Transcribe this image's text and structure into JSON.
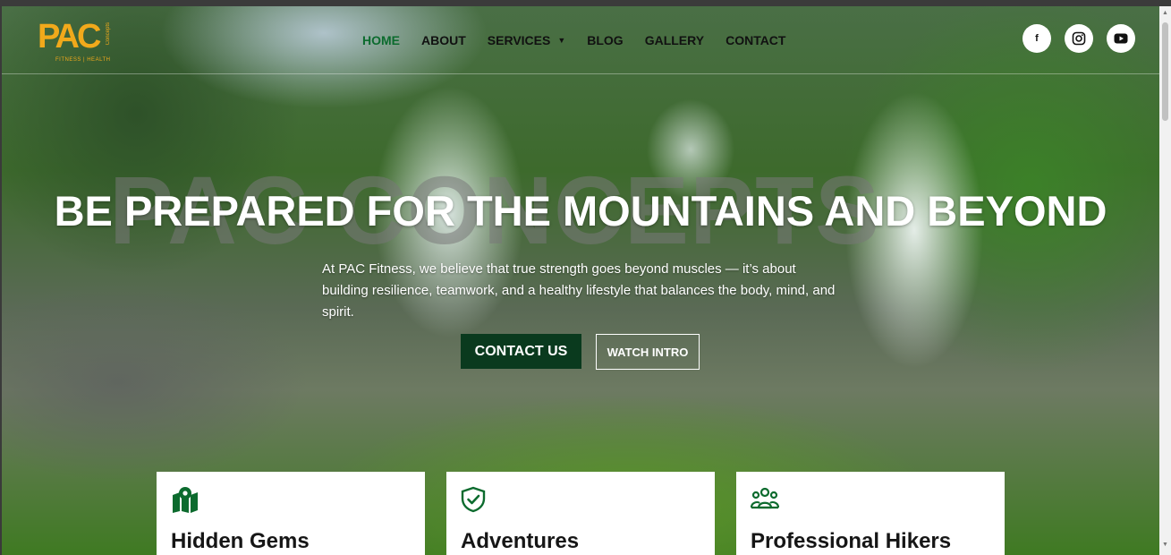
{
  "logo": {
    "text": "PAC",
    "tagline": "FITNESS | HEALTH",
    "side_text": "Concepts",
    "color": "#f1a91b"
  },
  "nav": {
    "items": [
      {
        "label": "HOME",
        "active": true
      },
      {
        "label": "ABOUT"
      },
      {
        "label": "SERVICES",
        "has_dropdown": true
      },
      {
        "label": "BLOG"
      },
      {
        "label": "GALLERY"
      },
      {
        "label": "CONTACT"
      }
    ],
    "active_color": "#0c6b2e"
  },
  "socials": [
    {
      "icon": "facebook-icon"
    },
    {
      "icon": "instagram-icon"
    },
    {
      "icon": "youtube-icon"
    }
  ],
  "hero": {
    "watermark": "PAC CONCEPTS",
    "headline": "BE PREPARED FOR THE MOUNTAINS AND BEYOND",
    "intro": "At PAC Fitness, we believe that true strength goes beyond muscles — it’s about building resilience, teamwork, and a healthy lifestyle that balances the body, mind, and spirit.",
    "contact_button": "CONTACT US",
    "watch_button": "WATCH INTRO",
    "brand_green": "#0a3a1e"
  },
  "cards": [
    {
      "icon": "map-marker-icon",
      "title": "Hidden Gems"
    },
    {
      "icon": "shield-check-icon",
      "title": "Adventures"
    },
    {
      "icon": "group-users-icon",
      "title": "Professional Hikers"
    }
  ]
}
